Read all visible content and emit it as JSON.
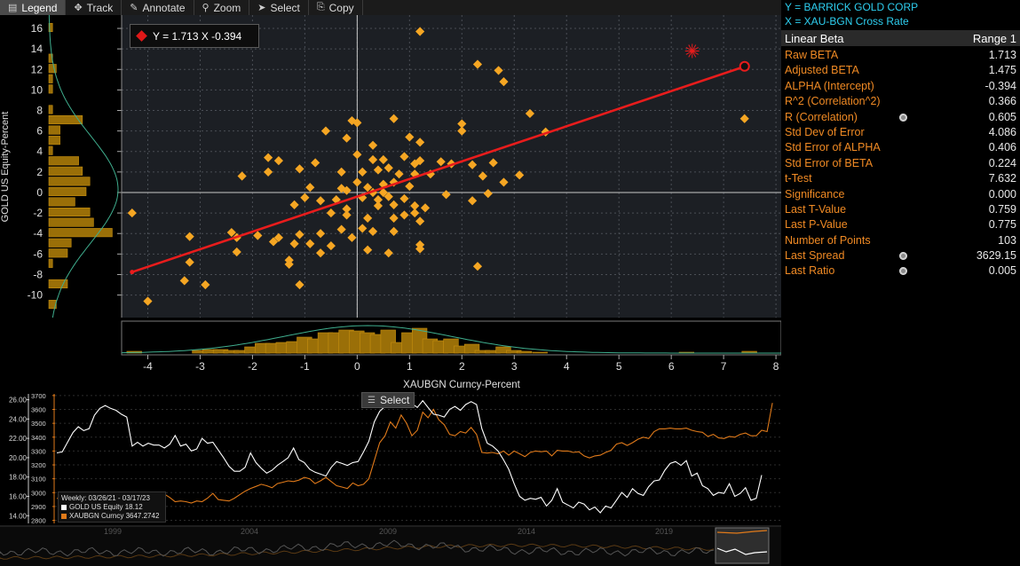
{
  "toolbar": {
    "buttons": [
      {
        "label": "Legend",
        "icon": "legend-icon",
        "glyph": "▤",
        "active": true
      },
      {
        "label": "Track",
        "icon": "track-crosshair-icon",
        "glyph": "✥",
        "active": false
      },
      {
        "label": "Annotate",
        "icon": "annotate-pen-icon",
        "glyph": "✎",
        "active": false
      },
      {
        "label": "Zoom",
        "icon": "zoom-magnifier-icon",
        "glyph": "⚲",
        "active": false
      },
      {
        "label": "Select",
        "icon": "select-cursor-icon",
        "glyph": "➤",
        "active": false
      },
      {
        "label": "Copy",
        "icon": "copy-icon",
        "glyph": "⎘",
        "active": false
      }
    ]
  },
  "stats": {
    "y_line": "Y = BARRICK GOLD CORP",
    "x_line": "X = XAU-BGN Cross Rate",
    "header_left": "Linear Beta",
    "header_right": "Range 1",
    "rows": [
      {
        "label": "Raw BETA",
        "value": "1.713",
        "icon": false
      },
      {
        "label": "Adjusted BETA",
        "value": "1.475",
        "icon": false
      },
      {
        "label": "ALPHA (Intercept)",
        "value": "-0.394",
        "icon": false
      },
      {
        "label": "R^2 (Correlation^2)",
        "value": "0.366",
        "icon": false
      },
      {
        "label": "R (Correlation)",
        "value": "0.605",
        "icon": true
      },
      {
        "label": "Std Dev of Error",
        "value": "4.086",
        "icon": false
      },
      {
        "label": "Std Error of ALPHA",
        "value": "0.406",
        "icon": false
      },
      {
        "label": "Std Error of BETA",
        "value": "0.224",
        "icon": false
      },
      {
        "label": "t-Test",
        "value": "7.632",
        "icon": false
      },
      {
        "label": "Significance",
        "value": "0.000",
        "icon": false
      },
      {
        "label": "Last T-Value",
        "value": "0.759",
        "icon": false
      },
      {
        "label": "Last P-Value",
        "value": "0.775",
        "icon": false
      },
      {
        "label": "Number of Points",
        "value": "103",
        "icon": false
      },
      {
        "label": "Last Spread",
        "value": "3629.15",
        "icon": true
      },
      {
        "label": "Last Ratio",
        "value": "0.005",
        "icon": true
      }
    ]
  },
  "equation": "Y = 1.713 X   -0.394",
  "ts_select_label": "Select",
  "ts_legend": {
    "range": "Weekly: 03/26/21 - 03/17/23",
    "series1": "GOLD US Equity  18.12",
    "series2": "XAUBGN Curncy  3647.2742"
  },
  "overview_years": [
    "1999",
    "2004",
    "2009",
    "2014",
    "2019"
  ],
  "chart_data": [
    {
      "type": "scatter",
      "xlabel": "XAUBGN Curncy-Percent",
      "ylabel": "GOLD US Equity-Percent",
      "xlim": [
        -4.5,
        8.1
      ],
      "ylim": [
        -12.2,
        17.3
      ],
      "xticks": [
        -4,
        -3,
        -2,
        -1,
        0,
        1,
        2,
        3,
        4,
        5,
        6,
        7,
        8
      ],
      "yticks": [
        -10,
        -8,
        -6,
        -4,
        -2,
        0,
        2,
        4,
        6,
        8,
        10,
        12,
        14,
        16
      ],
      "regression": {
        "slope": 1.713,
        "intercept": -0.394,
        "x_range": [
          -4.3,
          7.4
        ]
      },
      "last_point": {
        "x": 7.4,
        "y": 12.3
      },
      "points": [
        [
          1.2,
          15.7
        ],
        [
          2.3,
          12.5
        ],
        [
          2.7,
          11.9
        ],
        [
          2.8,
          10.8
        ],
        [
          7.4,
          7.2
        ],
        [
          3.3,
          7.7
        ],
        [
          -0.1,
          7.0
        ],
        [
          0.0,
          6.8
        ],
        [
          0.7,
          7.2
        ],
        [
          2.0,
          6.7
        ],
        [
          1.0,
          5.4
        ],
        [
          2.0,
          6.0
        ],
        [
          -0.6,
          6.0
        ],
        [
          -0.2,
          5.3
        ],
        [
          1.2,
          4.9
        ],
        [
          0.3,
          4.6
        ],
        [
          3.6,
          5.9
        ],
        [
          -1.7,
          3.4
        ],
        [
          0.0,
          3.7
        ],
        [
          0.9,
          3.5
        ],
        [
          0.3,
          3.2
        ],
        [
          0.5,
          3.2
        ],
        [
          1.1,
          2.8
        ],
        [
          -1.5,
          3.1
        ],
        [
          -0.8,
          2.9
        ],
        [
          -1.1,
          2.3
        ],
        [
          -1.7,
          2.0
        ],
        [
          -2.2,
          1.6
        ],
        [
          1.2,
          3.1
        ],
        [
          1.6,
          3.0
        ],
        [
          1.8,
          2.8
        ],
        [
          2.2,
          2.7
        ],
        [
          2.6,
          2.9
        ],
        [
          -0.3,
          2.0
        ],
        [
          0.1,
          2.0
        ],
        [
          0.4,
          2.2
        ],
        [
          0.6,
          2.4
        ],
        [
          0.8,
          1.8
        ],
        [
          1.1,
          1.8
        ],
        [
          1.4,
          1.8
        ],
        [
          0.0,
          1.0
        ],
        [
          0.2,
          0.5
        ],
        [
          0.5,
          0.8
        ],
        [
          0.7,
          1.0
        ],
        [
          1.0,
          0.6
        ],
        [
          3.1,
          1.7
        ],
        [
          2.4,
          1.6
        ],
        [
          2.8,
          1.0
        ],
        [
          -0.9,
          0.5
        ],
        [
          -0.3,
          0.4
        ],
        [
          -0.2,
          0.2
        ],
        [
          0.3,
          0.0
        ],
        [
          0.5,
          0.0
        ],
        [
          1.7,
          -0.2
        ],
        [
          2.5,
          -0.1
        ],
        [
          -1.0,
          -0.5
        ],
        [
          -0.7,
          -0.8
        ],
        [
          -0.4,
          -0.7
        ],
        [
          0.1,
          -0.5
        ],
        [
          0.4,
          -0.7
        ],
        [
          0.6,
          -0.4
        ],
        [
          0.9,
          -0.6
        ],
        [
          2.2,
          -0.8
        ],
        [
          -4.3,
          -2.0
        ],
        [
          -1.2,
          -1.2
        ],
        [
          -0.2,
          -1.6
        ],
        [
          0.4,
          -1.3
        ],
        [
          0.7,
          -1.2
        ],
        [
          1.1,
          -1.3
        ],
        [
          1.3,
          -1.5
        ],
        [
          -0.5,
          -2.0
        ],
        [
          -0.2,
          -2.2
        ],
        [
          0.2,
          -2.5
        ],
        [
          0.7,
          -2.5
        ],
        [
          0.9,
          -2.2
        ],
        [
          1.1,
          -2.0
        ],
        [
          -2.4,
          -3.9
        ],
        [
          -1.9,
          -4.2
        ],
        [
          -1.5,
          -4.4
        ],
        [
          -1.1,
          -4.1
        ],
        [
          -0.7,
          -4.0
        ],
        [
          -0.3,
          -3.6
        ],
        [
          0.1,
          -3.5
        ],
        [
          0.3,
          -3.8
        ],
        [
          0.7,
          -3.8
        ],
        [
          1.2,
          -2.8
        ],
        [
          -3.2,
          -4.3
        ],
        [
          -2.3,
          -4.4
        ],
        [
          -1.6,
          -4.8
        ],
        [
          -1.2,
          -5.0
        ],
        [
          -0.9,
          -5.0
        ],
        [
          -0.5,
          -5.2
        ],
        [
          0.2,
          -5.6
        ],
        [
          0.6,
          -5.9
        ],
        [
          1.2,
          -5.1
        ],
        [
          1.2,
          -5.5
        ],
        [
          -2.3,
          -5.8
        ],
        [
          -3.2,
          -6.8
        ],
        [
          -1.3,
          -6.6
        ],
        [
          -1.3,
          -7.0
        ],
        [
          2.3,
          -7.2
        ],
        [
          -3.3,
          -8.6
        ],
        [
          -2.9,
          -9.0
        ],
        [
          -1.1,
          -9.0
        ],
        [
          -4.0,
          -10.6
        ],
        [
          -0.7,
          -5.9
        ],
        [
          -0.1,
          -4.4
        ]
      ],
      "y_histogram": [
        [
          16,
          1
        ],
        [
          13,
          1
        ],
        [
          12,
          2
        ],
        [
          11,
          1
        ],
        [
          10,
          1
        ],
        [
          8,
          1
        ],
        [
          7,
          9
        ],
        [
          6,
          3
        ],
        [
          5,
          3
        ],
        [
          4,
          1
        ],
        [
          3,
          8
        ],
        [
          2,
          9
        ],
        [
          1,
          11
        ],
        [
          0,
          10
        ],
        [
          -1,
          7
        ],
        [
          -2,
          11
        ],
        [
          -3,
          12
        ],
        [
          -4,
          17
        ],
        [
          -5,
          6
        ],
        [
          -6,
          5
        ],
        [
          -7,
          1
        ],
        [
          -9,
          5
        ],
        [
          -11,
          2
        ]
      ],
      "x_histogram": [
        [
          -4.25,
          2
        ],
        [
          -3.0,
          3
        ],
        [
          -2.8,
          4
        ],
        [
          -2.6,
          4
        ],
        [
          -2.4,
          3
        ],
        [
          -2.2,
          3
        ],
        [
          -2.0,
          7
        ],
        [
          -1.8,
          11
        ],
        [
          -1.6,
          11
        ],
        [
          -1.4,
          12
        ],
        [
          -1.2,
          13
        ],
        [
          -1.0,
          18
        ],
        [
          -0.8,
          16
        ],
        [
          -0.6,
          23
        ],
        [
          -0.4,
          23
        ],
        [
          -0.2,
          26
        ],
        [
          0.0,
          25
        ],
        [
          0.2,
          23
        ],
        [
          0.4,
          21
        ],
        [
          0.6,
          26
        ],
        [
          0.8,
          12
        ],
        [
          1.0,
          23
        ],
        [
          1.2,
          28
        ],
        [
          1.4,
          16
        ],
        [
          1.6,
          14
        ],
        [
          1.8,
          16
        ],
        [
          2.0,
          8
        ],
        [
          2.2,
          10
        ],
        [
          2.4,
          3
        ],
        [
          2.6,
          3
        ],
        [
          2.8,
          7
        ],
        [
          3.0,
          3
        ],
        [
          3.2,
          2
        ],
        [
          3.5,
          1
        ],
        [
          6.3,
          1
        ],
        [
          7.5,
          2
        ]
      ]
    },
    {
      "type": "line",
      "title": "Weekly: 03/26/21 - 03/17/23",
      "left_axis": {
        "ticks": [
          "26.00",
          "24.00",
          "22.00",
          "20.00",
          "18.00",
          "16.00",
          "14.00"
        ],
        "range": [
          13.2,
          26.6
        ]
      },
      "right_axis": {
        "ticks": [
          "3700",
          "3600",
          "3500",
          "3400",
          "3300",
          "3200",
          "3100",
          "3000",
          "2900",
          "2800"
        ],
        "range": [
          2778,
          3712
        ]
      },
      "series": [
        {
          "name": "GOLD US Equity",
          "color": "#ffffff",
          "values": [
            20.5,
            20.6,
            21.6,
            22.6,
            23.2,
            22.8,
            23.0,
            24.4,
            25.1,
            25.4,
            25.1,
            24.9,
            24.5,
            24.2,
            21.2,
            21.6,
            21.2,
            21.5,
            21.3,
            21.3,
            21.0,
            21.4,
            22.3,
            21.2,
            21.4,
            20.7,
            20.9,
            22.0,
            21.5,
            21.6,
            20.8,
            20.0,
            19.1,
            18.6,
            18.6,
            19.0,
            20.5,
            19.5,
            18.9,
            18.4,
            18.7,
            19.2,
            19.6,
            20.0,
            21.0,
            19.8,
            19.5,
            18.8,
            18.5,
            18.3,
            18.1,
            19.0,
            19.6,
            19.4,
            19.2,
            19.5,
            19.6,
            20.6,
            21.7,
            23.7,
            24.8,
            25.3,
            25.6,
            25.3,
            25.6,
            25.9,
            25.6,
            25.2,
            25.9,
            25.2,
            24.5,
            24.4,
            24.2,
            25.0,
            25.3,
            24.9,
            25.5,
            25.8,
            25.5,
            23.0,
            21.5,
            21.2,
            20.7,
            19.8,
            18.8,
            17.3,
            16.0,
            15.6,
            15.8,
            15.7,
            15.9,
            15.0,
            15.6,
            16.8,
            15.4,
            15.1,
            14.8,
            15.4,
            15.2,
            14.6,
            14.9,
            14.3,
            15.0,
            14.8,
            15.6,
            16.4,
            15.9,
            16.8,
            16.3,
            16.1,
            17.0,
            17.6,
            17.7,
            18.7,
            19.4,
            19.6,
            19.2,
            19.7,
            18.1,
            18.4,
            17.1,
            16.8,
            16.1,
            16.4,
            16.3,
            17.3,
            16.0,
            16.3,
            16.9,
            15.6,
            15.8,
            18.2
          ]
        },
        {
          "name": "XAUBGN Curncy",
          "color": "#e07a1a",
          "values": [
            2960,
            2950,
            2935,
            2930,
            2940,
            2950,
            2940,
            2960,
            2950,
            2940,
            2935,
            2940,
            2930,
            2925,
            2980,
            2990,
            2975,
            2990,
            2975,
            2985,
            2990,
            2965,
            2935,
            2940,
            2935,
            2925,
            2940,
            2935,
            2960,
            2995,
            2950,
            2945,
            2940,
            2960,
            2985,
            3010,
            3030,
            3045,
            3060,
            3050,
            3035,
            3065,
            3075,
            3085,
            3080,
            3090,
            3110,
            3100,
            3065,
            3085,
            3110,
            3080,
            3050,
            3040,
            3030,
            3070,
            3050,
            3060,
            3100,
            3230,
            3360,
            3410,
            3510,
            3465,
            3560,
            3500,
            3410,
            3450,
            3580,
            3540,
            3600,
            3525,
            3490,
            3420,
            3410,
            3440,
            3430,
            3470,
            3420,
            3290,
            3285,
            3290,
            3280,
            3300,
            3270,
            3300,
            3280,
            3260,
            3290,
            3300,
            3295,
            3300,
            3265,
            3305,
            3300,
            3300,
            3290,
            3295,
            3265,
            3250,
            3265,
            3270,
            3290,
            3305,
            3350,
            3360,
            3340,
            3360,
            3385,
            3400,
            3390,
            3440,
            3460,
            3460,
            3465,
            3460,
            3460,
            3465,
            3450,
            3440,
            3435,
            3405,
            3420,
            3395,
            3390,
            3405,
            3400,
            3420,
            3430,
            3410,
            3410,
            3450,
            3440,
            3647
          ]
        }
      ]
    }
  ]
}
